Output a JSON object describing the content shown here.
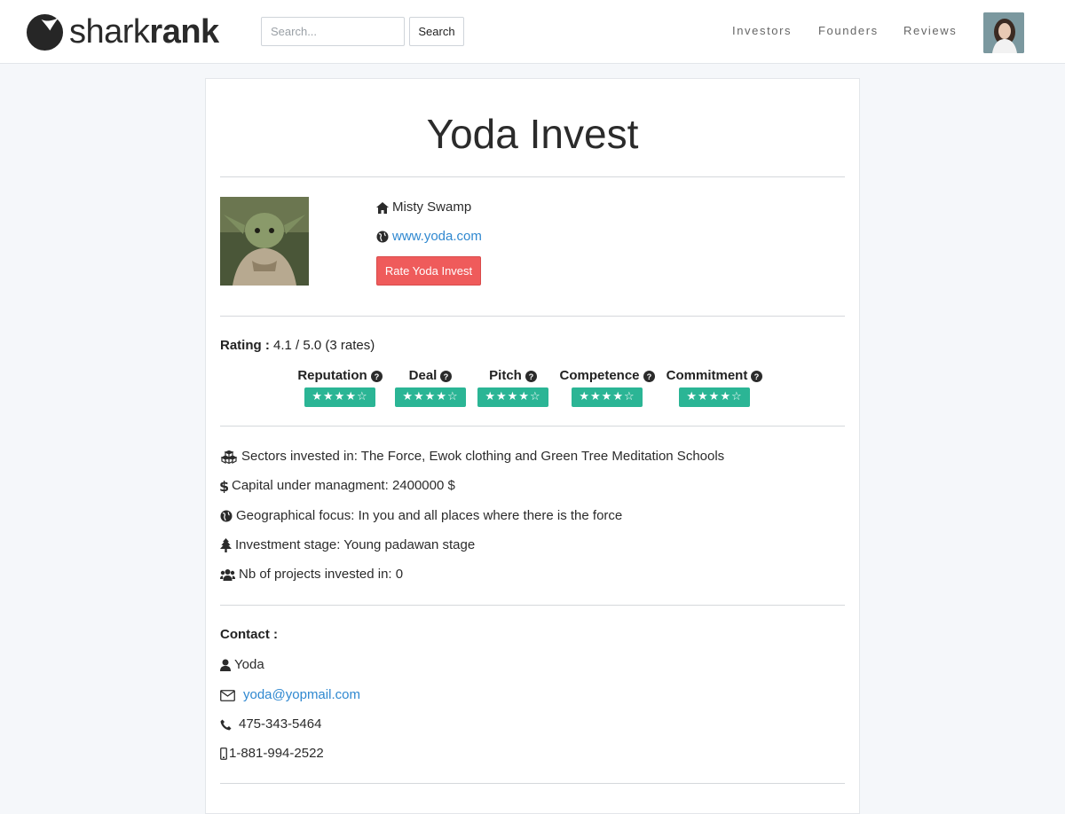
{
  "brand": {
    "light": "shark",
    "bold": "rank"
  },
  "search": {
    "placeholder": "Search...",
    "button_label": "Search"
  },
  "nav": {
    "investors": "Investors",
    "founders": "Founders",
    "reviews": "Reviews"
  },
  "investor": {
    "name": "Yoda Invest",
    "location": "Misty Swamp",
    "website": "www.yoda.com",
    "rate_button": "Rate Yoda Invest"
  },
  "rating": {
    "label": "Rating :",
    "value": "4.1 / 5.0 (3 rates)",
    "criteria": [
      {
        "label": "Reputation",
        "stars": 4,
        "max": 5
      },
      {
        "label": "Deal",
        "stars": 4,
        "max": 5
      },
      {
        "label": "Pitch",
        "stars": 4,
        "max": 5
      },
      {
        "label": "Competence",
        "stars": 4,
        "max": 5
      },
      {
        "label": "Commitment",
        "stars": 4,
        "max": 5
      }
    ],
    "stars_display": "★★★★☆"
  },
  "details": {
    "sectors": "Sectors invested in: The Force, Ewok clothing and Green Tree Meditation Schools",
    "capital": "Capital under managment: 2400000 $",
    "geo": "Geographical focus: In you and all places where there is the force",
    "stage": "Investment stage: Young padawan stage",
    "projects": "Nb of projects invested in: 0"
  },
  "contact": {
    "title": "Contact :",
    "name": "Yoda",
    "email": "yoda@yopmail.com",
    "phone": "475-343-5464",
    "mobile": "1-881-994-2522"
  },
  "colors": {
    "accent_button": "#ef5b5b",
    "star_badge": "#2bb595",
    "link": "#2f88d0"
  },
  "icons": {
    "location": "home-icon",
    "website": "globe-icon",
    "sectors": "cubes-icon",
    "capital": "dollar-icon",
    "geo": "globe-icon",
    "stage": "tree-icon",
    "projects": "users-icon",
    "contact_name": "user-icon",
    "email": "envelope-icon",
    "phone": "phone-icon",
    "mobile": "mobile-icon",
    "help": "question-circle-icon"
  }
}
